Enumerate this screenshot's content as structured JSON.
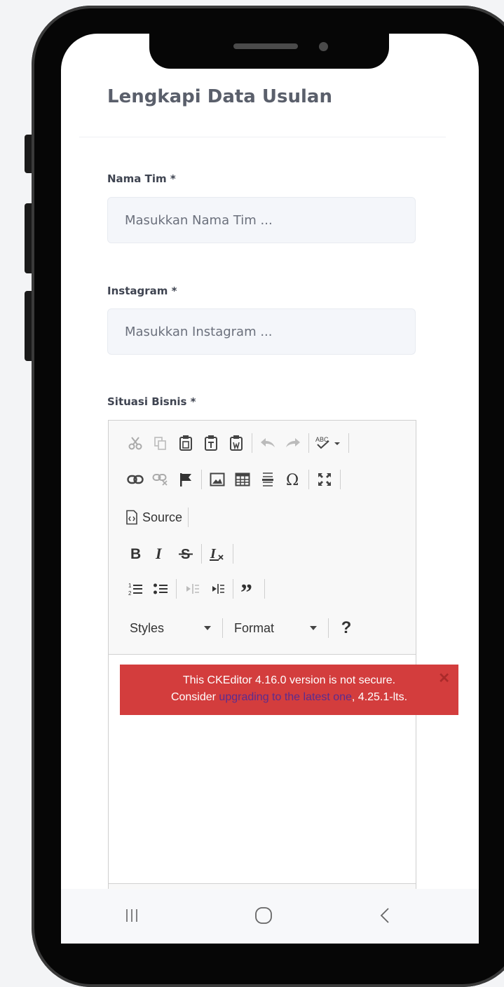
{
  "page": {
    "title": "Lengkapi Data Usulan"
  },
  "form": {
    "team_name": {
      "label": "Nama Tim *",
      "placeholder": "Masukkan Nama Tim ...",
      "value": ""
    },
    "instagram": {
      "label": "Instagram *",
      "placeholder": "Masukkan Instagram ...",
      "value": ""
    },
    "business_situation": {
      "label": "Situasi Bisnis *"
    }
  },
  "editor": {
    "toolbar": {
      "row1": [
        "cut-icon",
        "copy-icon",
        "paste-icon",
        "paste-text-icon",
        "paste-word-icon",
        "undo-icon",
        "redo-icon",
        "spellcheck-icon"
      ],
      "row2": [
        "link-icon",
        "unlink-icon",
        "anchor-icon",
        "image-icon",
        "table-icon",
        "horizontal-line-icon",
        "special-char-icon",
        "maximize-icon"
      ],
      "source_label": "Source",
      "row4": [
        "bold-icon",
        "italic-icon",
        "strike-icon",
        "remove-format-icon"
      ],
      "row5": [
        "numbered-list-icon",
        "bulleted-list-icon",
        "outdent-icon",
        "indent-icon",
        "blockquote-icon"
      ],
      "styles_label": "Styles",
      "format_label": "Format",
      "help_label": "?"
    },
    "notice": {
      "line1": "This CKEditor 4.16.0 version is not secure.",
      "line2_prefix": "Consider ",
      "line2_link": "upgrading to the latest one",
      "line2_suffix": ", 4.25.1-lts.",
      "close_label": "✕"
    },
    "colors": {
      "notice_bg": "#d33d3d",
      "link": "#5b2c8f"
    }
  },
  "navbar": {
    "items": [
      "recent-apps-icon",
      "home-icon",
      "back-icon"
    ]
  }
}
